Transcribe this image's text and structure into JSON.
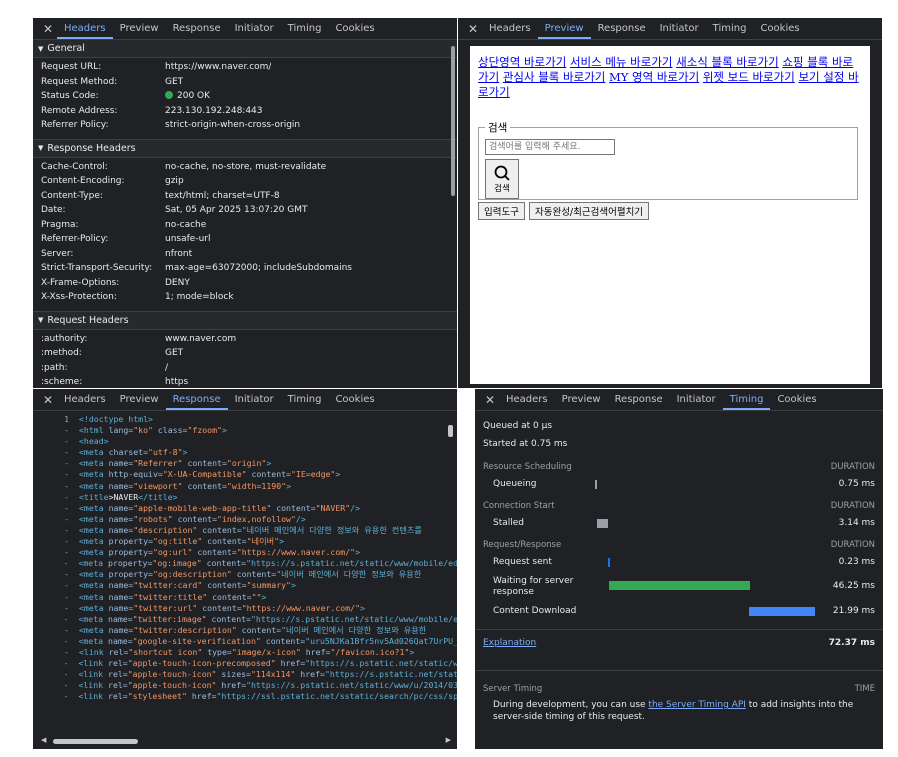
{
  "headers_panel": {
    "tabs": [
      "Headers",
      "Preview",
      "Response",
      "Initiator",
      "Timing",
      "Cookies"
    ],
    "active_tab": "Headers",
    "sections": [
      {
        "title": "General",
        "rows": [
          {
            "k": "Request URL:",
            "v": "https://www.naver.com/"
          },
          {
            "k": "Request Method:",
            "v": "GET"
          },
          {
            "k": "Status Code:",
            "v": "200 OK"
          },
          {
            "k": "Remote Address:",
            "v": "223.130.192.248:443"
          },
          {
            "k": "Referrer Policy:",
            "v": "strict-origin-when-cross-origin"
          }
        ]
      },
      {
        "title": "Response Headers",
        "rows": [
          {
            "k": "Cache-Control:",
            "v": "no-cache, no-store, must-revalidate"
          },
          {
            "k": "Content-Encoding:",
            "v": "gzip"
          },
          {
            "k": "Content-Type:",
            "v": "text/html; charset=UTF-8"
          },
          {
            "k": "Date:",
            "v": "Sat, 05 Apr 2025 13:07:20 GMT"
          },
          {
            "k": "Pragma:",
            "v": "no-cache"
          },
          {
            "k": "Referrer-Policy:",
            "v": "unsafe-url"
          },
          {
            "k": "Server:",
            "v": "nfront"
          },
          {
            "k": "Strict-Transport-Security:",
            "v": "max-age=63072000; includeSubdomains"
          },
          {
            "k": "X-Frame-Options:",
            "v": "DENY"
          },
          {
            "k": "X-Xss-Protection:",
            "v": "1; mode=block"
          }
        ]
      },
      {
        "title": "Request Headers",
        "rows": [
          {
            "k": ":authority:",
            "v": "www.naver.com"
          },
          {
            "k": ":method:",
            "v": "GET"
          },
          {
            "k": ":path:",
            "v": "/"
          },
          {
            "k": ":scheme:",
            "v": "https"
          }
        ]
      }
    ]
  },
  "preview_panel": {
    "tabs": [
      "Headers",
      "Preview",
      "Response",
      "Initiator",
      "Timing",
      "Cookies"
    ],
    "active_tab": "Preview",
    "skip_links": [
      "상단영역 바로가기",
      "서비스 메뉴 바로가기",
      "새소식 블록 바로가기",
      "쇼핑 블록 바로가기",
      "관심사 블록 바로가기",
      "MY 영역 바로가기",
      "위젯 보드 바로가기",
      "보기 설정 바로가기"
    ],
    "search_legend": "검색",
    "search_placeholder": "검색어를 입력해 주세요.",
    "search_button": "검색",
    "input_tool_button": "입력도구",
    "autocomplete_button": "자동완성/최근검색어펼치기"
  },
  "response_panel": {
    "tabs": [
      "Headers",
      "Preview",
      "Response",
      "Initiator",
      "Timing",
      "Cookies"
    ],
    "active_tab": "Response",
    "lines": [
      {
        "n": "1",
        "t": "<!doctype html>"
      },
      {
        "n": "-",
        "t": "<html lang=\"ko\" class=\"fzoom\">"
      },
      {
        "n": "-",
        "t": "    <head>"
      },
      {
        "n": "-",
        "t": "        <meta charset=\"utf-8\">"
      },
      {
        "n": "-",
        "t": "        <meta name=\"Referrer\" content=\"origin\">"
      },
      {
        "n": "-",
        "t": "        <meta http-equiv=\"X-UA-Compatible\" content=\"IE=edge\">"
      },
      {
        "n": "-",
        "t": "        <meta name=\"viewport\" content=\"width=1190\">"
      },
      {
        "n": "-",
        "t": "        <title>NAVER</title>"
      },
      {
        "n": "-",
        "t": "        <meta name=\"apple-mobile-web-app-title\" content=\"NAVER\"/>"
      },
      {
        "n": "-",
        "t": "        <meta name=\"robots\" content=\"index,nofollow\"/>"
      },
      {
        "n": "-",
        "t": "        <meta name=\"description\" content=\"네이버 메인에서 다양한 정보와 유용한 컨텐츠를"
      },
      {
        "n": "-",
        "t": "        <meta property=\"og:title\" content=\"네이버\">"
      },
      {
        "n": "-",
        "t": "        <meta property=\"og:url\" content=\"https://www.naver.com/\">"
      },
      {
        "n": "-",
        "t": "        <meta property=\"og:image\" content=\"https://s.pstatic.net/static/www/mobile/edi"
      },
      {
        "n": "-",
        "t": "        <meta property=\"og:description\" content=\"네이버 메인에서 다양한 정보와 유용한"
      },
      {
        "n": "-",
        "t": "        <meta name=\"twitter:card\" content=\"summary\">"
      },
      {
        "n": "-",
        "t": "        <meta name=\"twitter:title\" content=\"\">"
      },
      {
        "n": "-",
        "t": "        <meta name=\"twitter:url\" content=\"https://www.naver.com/\">"
      },
      {
        "n": "-",
        "t": "        <meta name=\"twitter:image\" content=\"https://s.pstatic.net/static/www/mobile/ed"
      },
      {
        "n": "-",
        "t": "        <meta name=\"twitter:description\" content=\"네이버 메인에서 다양한 정보와 유용한"
      },
      {
        "n": "-",
        "t": "        <meta name=\"google-site-verification\" content=\"uru5NJKa1Bfr5nv5Ad026Qat7UrPU_0"
      },
      {
        "n": "-",
        "t": "        <link rel=\"shortcut icon\" type=\"image/x-icon\" href=\"/favicon.ico?1\">"
      },
      {
        "n": "-",
        "t": "        <link rel=\"apple-touch-icon-precomposed\" href=\"https://s.pstatic.net/static/ww"
      },
      {
        "n": "-",
        "t": "        <link rel=\"apple-touch-icon\" sizes=\"114x114\" href=\"https://s.pstatic.net/stati"
      },
      {
        "n": "-",
        "t": "        <link rel=\"apple-touch-icon\" href=\"https://s.pstatic.net/static/www/u/2014/032"
      },
      {
        "n": "-",
        "t": "        <link rel=\"stylesheet\" href=\"https://ssl.pstatic.net/sstatic/search/pc/css/sp_"
      }
    ]
  },
  "timing_panel": {
    "tabs": [
      "Headers",
      "Preview",
      "Response",
      "Initiator",
      "Timing",
      "Cookies"
    ],
    "active_tab": "Timing",
    "queued_at": "Queued at 0 µs",
    "started_at": "Started at 0.75 ms",
    "duration_label": "DURATION",
    "groups": [
      {
        "title": "Resource Scheduling",
        "rows": [
          {
            "label": "Queueing",
            "value": "0.75 ms",
            "start": 0.0,
            "width": 0.01,
            "color": "#9aa0a6"
          }
        ]
      },
      {
        "title": "Connection Start",
        "rows": [
          {
            "label": "Stalled",
            "value": "3.14 ms",
            "start": 0.01,
            "width": 0.05,
            "color": "#9aa0a6"
          }
        ]
      },
      {
        "title": "Request/Response",
        "rows": [
          {
            "label": "Request sent",
            "value": "0.23 ms",
            "start": 0.06,
            "width": 0.004,
            "color": "#1a73e8"
          },
          {
            "label": "Waiting for server response",
            "value": "46.25 ms",
            "start": 0.065,
            "width": 0.64,
            "color": "#34a853"
          },
          {
            "label": "Content Download",
            "value": "21.99 ms",
            "start": 0.7,
            "width": 0.3,
            "color": "#4285f4"
          }
        ]
      }
    ],
    "explanation_link": "Explanation",
    "total": "72.37 ms",
    "server_timing_title": "Server Timing",
    "time_label": "TIME",
    "server_note_prefix": "During development, you can use ",
    "server_note_link": "the Server Timing API",
    "server_note_suffix": " to add insights into the server-side timing of this request."
  }
}
